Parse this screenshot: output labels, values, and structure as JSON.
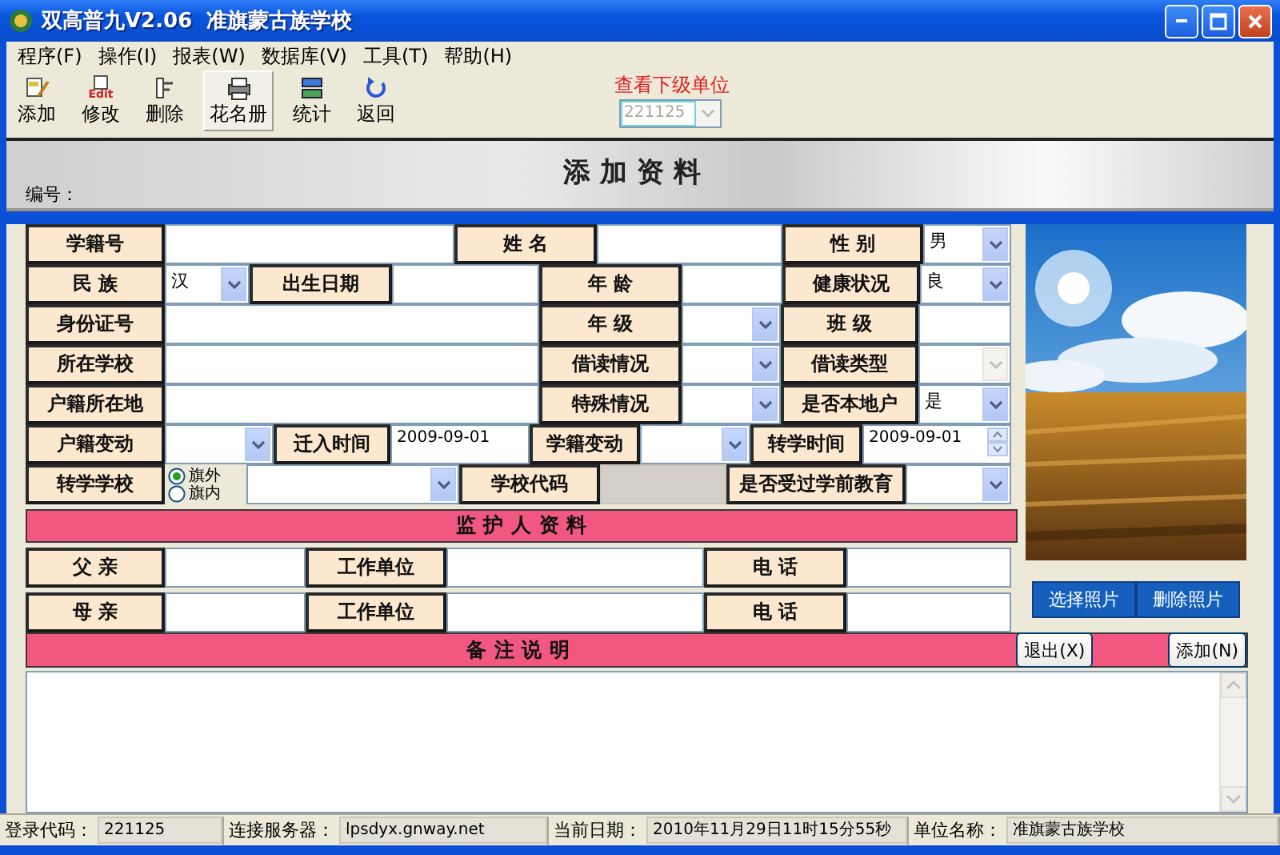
{
  "window": {
    "title": "双高普九V2.06  准旗蒙古族学校"
  },
  "menu": [
    "程序(F)",
    "操作(I)",
    "报表(W)",
    "数据库(V)",
    "工具(T)",
    "帮助(H)"
  ],
  "toolbar": {
    "buttons": [
      {
        "label": "添加",
        "pressed": false
      },
      {
        "label": "修改",
        "icon_text": "Edit",
        "pressed": false
      },
      {
        "label": "删除",
        "pressed": false
      },
      {
        "label": "花名册",
        "pressed": true
      },
      {
        "label": "统计",
        "pressed": false
      },
      {
        "label": "返回",
        "pressed": false
      }
    ],
    "unit_picker": {
      "label": "查看下级单位",
      "value": "221125",
      "disabled": true
    }
  },
  "header": {
    "title": "添 加 资 料",
    "number_label": "编号："
  },
  "form": {
    "lines": [
      {
        "fields": [
          {
            "kind": "label",
            "text": "学籍号"
          },
          {
            "kind": "text"
          },
          {
            "kind": "label",
            "text": "姓 名"
          },
          {
            "kind": "text"
          },
          {
            "kind": "label",
            "text": "性 别"
          },
          {
            "kind": "combo",
            "value": "男"
          }
        ]
      },
      {
        "fields": [
          {
            "kind": "label",
            "text": "民 族"
          },
          {
            "kind": "combo",
            "value": "汉"
          },
          {
            "kind": "label",
            "text": "出生日期"
          },
          {
            "kind": "text"
          },
          {
            "kind": "label",
            "text": "年 龄"
          },
          {
            "kind": "text"
          },
          {
            "kind": "label",
            "text": "健康状况"
          },
          {
            "kind": "combo",
            "value": "良"
          }
        ]
      },
      {
        "fields": [
          {
            "kind": "label",
            "text": "身份证号"
          },
          {
            "kind": "text"
          },
          {
            "kind": "label",
            "text": "年 级"
          },
          {
            "kind": "combo"
          },
          {
            "kind": "label",
            "text": "班 级"
          },
          {
            "kind": "text"
          }
        ]
      },
      {
        "fields": [
          {
            "kind": "label",
            "text": "所在学校"
          },
          {
            "kind": "text"
          },
          {
            "kind": "label",
            "text": "借读情况"
          },
          {
            "kind": "combo"
          },
          {
            "kind": "label",
            "text": "借读类型"
          },
          {
            "kind": "combo",
            "disabled": true
          }
        ]
      },
      {
        "fields": [
          {
            "kind": "label",
            "text": "户籍所在地"
          },
          {
            "kind": "text"
          },
          {
            "kind": "label",
            "text": "特殊情况"
          },
          {
            "kind": "combo"
          },
          {
            "kind": "label",
            "text": "是否本地户"
          },
          {
            "kind": "combo",
            "value": "是"
          }
        ]
      },
      {
        "fields": [
          {
            "kind": "label",
            "text": "户籍变动"
          },
          {
            "kind": "combo"
          },
          {
            "kind": "label",
            "text": "迁入时间"
          },
          {
            "kind": "date",
            "value": "2009-09-01"
          },
          {
            "kind": "label",
            "text": "学籍变动"
          },
          {
            "kind": "combo"
          },
          {
            "kind": "label",
            "text": "转学时间"
          },
          {
            "kind": "spin",
            "value": "2009-09-01"
          }
        ]
      },
      {
        "fields": [
          {
            "kind": "label",
            "text": "转学学校"
          },
          {
            "kind": "radio",
            "options": [
              {
                "label": "旗外",
                "selected": true
              },
              {
                "label": "旗内",
                "selected": false
              }
            ]
          },
          {
            "kind": "combo"
          },
          {
            "kind": "label",
            "text": "学校代码"
          },
          {
            "kind": "text",
            "disabled": true
          },
          {
            "kind": "label",
            "text": "是否受过学前教育"
          },
          {
            "kind": "combo"
          }
        ]
      }
    ]
  },
  "photo": {
    "kind": "picture",
    "buttons": [
      "选择照片",
      "删除照片"
    ]
  },
  "guardian": {
    "title": "监 护 人 资 料",
    "rows": [
      [
        {
          "kind": "label",
          "text": "父 亲"
        },
        {
          "kind": "text"
        },
        {
          "kind": "label",
          "text": "工作单位"
        },
        {
          "kind": "text"
        },
        {
          "kind": "label",
          "text": "电 话"
        },
        {
          "kind": "text"
        }
      ],
      [
        {
          "kind": "label",
          "text": "母 亲"
        },
        {
          "kind": "text"
        },
        {
          "kind": "label",
          "text": "工作单位"
        },
        {
          "kind": "text"
        },
        {
          "kind": "label",
          "text": "电 话"
        },
        {
          "kind": "text"
        }
      ]
    ]
  },
  "remarks": {
    "title": "备 注 说 明",
    "buttons": [
      "退出(X)",
      "添加(N)"
    ]
  },
  "status_bar": [
    {
      "label": "登录代码：",
      "value": "221125"
    },
    {
      "label": "连接服务器：",
      "value": "lpsdyx.gnway.net"
    },
    {
      "label": "当前日期：",
      "value": "2010年11月29日11时15分55秒"
    },
    {
      "label": "单位名称：",
      "value": "准旗蒙古族学校"
    }
  ]
}
